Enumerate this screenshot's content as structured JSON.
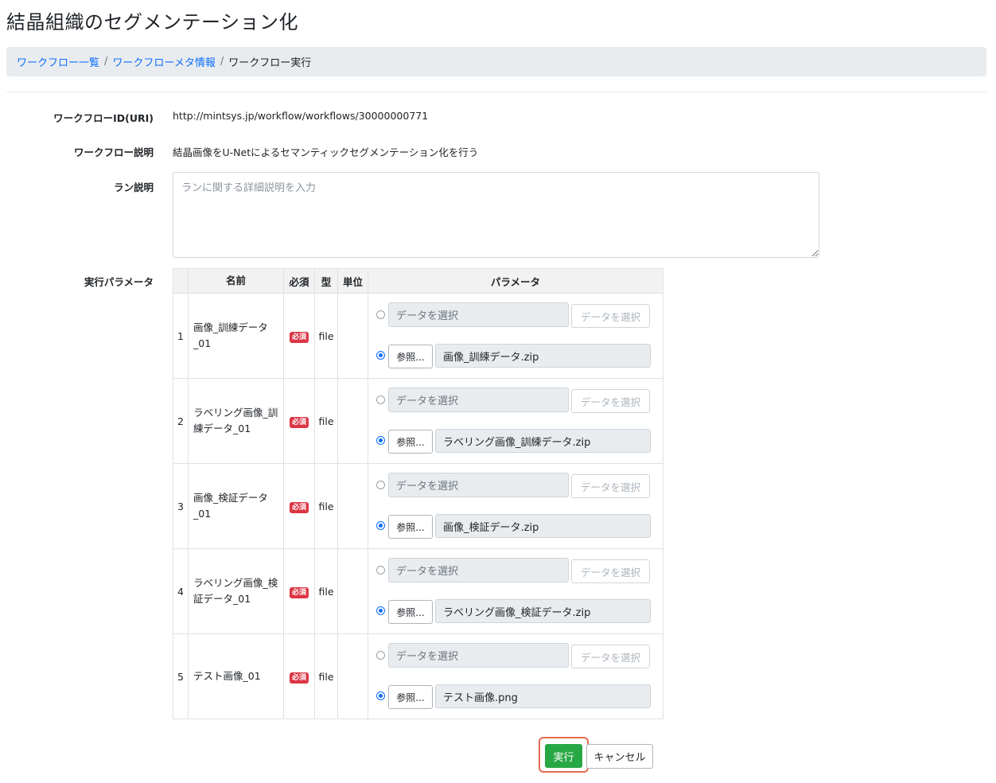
{
  "page_title": "結晶組織のセグメンテーション化",
  "breadcrumb": {
    "items": [
      {
        "label": "ワークフロー一覧"
      },
      {
        "label": "ワークフローメタ情報"
      }
    ],
    "separator": "/",
    "current": "ワークフロー実行"
  },
  "form": {
    "workflow_id_label": "ワークフローID(URI)",
    "workflow_id_value": "http://mintsys.jp/workflow/workflows/30000000771",
    "workflow_desc_label": "ワークフロー説明",
    "workflow_desc_value": "結晶画像をU-Netによるセマンティックセグメンテーション化を行う",
    "run_desc_label": "ラン説明",
    "run_desc_placeholder": "ランに関する詳細説明を入力",
    "run_desc_value": "",
    "exec_params_label": "実行パラメータ"
  },
  "params_table": {
    "headers": {
      "index": "",
      "name": "名前",
      "required": "必須",
      "type": "型",
      "unit": "単位",
      "param": "パラメータ"
    },
    "required_badge": "必須",
    "data_select_placeholder": "データを選択",
    "data_select_button": "データを選択",
    "browse_button": "参照...",
    "rows": [
      {
        "index": "1",
        "name": "画像_訓練データ_01",
        "type": "file",
        "unit": "",
        "file": "画像_訓練データ.zip"
      },
      {
        "index": "2",
        "name": "ラベリング画像_訓練データ_01",
        "type": "file",
        "unit": "",
        "file": "ラベリング画像_訓練データ.zip"
      },
      {
        "index": "3",
        "name": "画像_検証データ_01",
        "type": "file",
        "unit": "",
        "file": "画像_検証データ.zip"
      },
      {
        "index": "4",
        "name": "ラベリング画像_検証データ_01",
        "type": "file",
        "unit": "",
        "file": "ラベリング画像_検証データ.zip"
      },
      {
        "index": "5",
        "name": "テスト画像_01",
        "type": "file",
        "unit": "",
        "file": "テスト画像.png"
      }
    ]
  },
  "actions": {
    "execute_label": "実行",
    "cancel_label": "キャンセル"
  },
  "colors": {
    "link": "#0d6efd",
    "execute": "#28a745",
    "required_badge": "#dc3545",
    "highlight": "#e06c4f"
  }
}
